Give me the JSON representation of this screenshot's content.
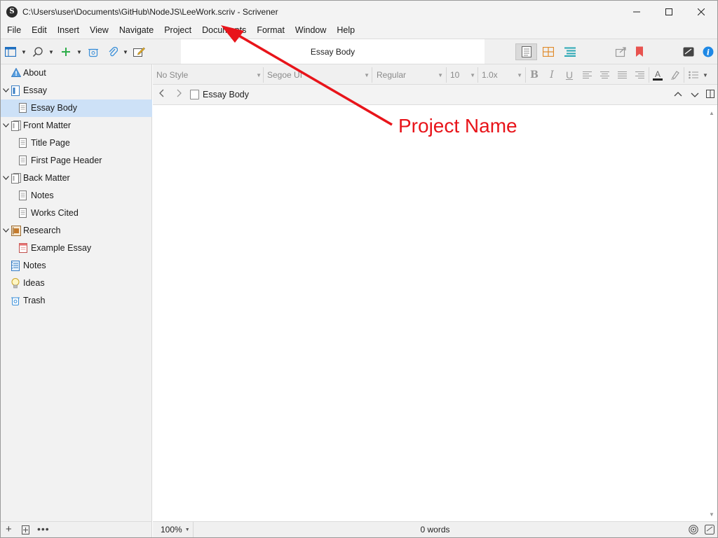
{
  "window": {
    "title": "C:\\Users\\user\\Documents\\GitHub\\NodeJS\\LeeWork.scriv - Scrivener",
    "app_icon_letter": "S"
  },
  "menu": [
    "File",
    "Edit",
    "Insert",
    "View",
    "Navigate",
    "Project",
    "Documents",
    "Format",
    "Window",
    "Help"
  ],
  "toolbar": {
    "document_title": "Essay Body"
  },
  "binder": {
    "items": [
      {
        "label": "About",
        "icon": "info-warning-icon",
        "depth": 0,
        "disclosure": "",
        "selected": false
      },
      {
        "label": "Essay",
        "icon": "draft-folder-icon",
        "depth": 0,
        "disclosure": "expanded",
        "selected": false
      },
      {
        "label": "Essay Body",
        "icon": "document-icon",
        "depth": 1,
        "disclosure": "",
        "selected": true
      },
      {
        "label": "Front Matter",
        "icon": "stack-folder-icon",
        "depth": 0,
        "disclosure": "expanded",
        "selected": false
      },
      {
        "label": "Title Page",
        "icon": "document-icon",
        "depth": 1,
        "disclosure": "",
        "selected": false
      },
      {
        "label": "First Page Header",
        "icon": "document-icon",
        "depth": 1,
        "disclosure": "",
        "selected": false
      },
      {
        "label": "Back Matter",
        "icon": "stack-folder-icon",
        "depth": 0,
        "disclosure": "expanded",
        "selected": false
      },
      {
        "label": "Notes",
        "icon": "document-icon",
        "depth": 1,
        "disclosure": "",
        "selected": false
      },
      {
        "label": "Works Cited",
        "icon": "document-icon",
        "depth": 1,
        "disclosure": "",
        "selected": false
      },
      {
        "label": "Research",
        "icon": "research-folder-icon",
        "depth": 0,
        "disclosure": "expanded",
        "selected": false
      },
      {
        "label": "Example Essay",
        "icon": "pdf-document-icon",
        "depth": 1,
        "disclosure": "",
        "selected": false
      },
      {
        "label": "Notes",
        "icon": "notebook-icon",
        "depth": 0,
        "disclosure": "",
        "selected": false
      },
      {
        "label": "Ideas",
        "icon": "lightbulb-icon",
        "depth": 0,
        "disclosure": "",
        "selected": false
      },
      {
        "label": "Trash",
        "icon": "trash-icon",
        "depth": 0,
        "disclosure": "",
        "selected": false
      }
    ]
  },
  "format_bar": {
    "style": "No Style",
    "font": "Segoe UI",
    "weight": "Regular",
    "size": "10",
    "line_spacing": "1.0x"
  },
  "header_bar": {
    "title": "Essay Body"
  },
  "footer": {
    "zoom": "100%",
    "word_count": "0 words"
  },
  "annotation": {
    "text": "Project Name",
    "color": "#e8141a"
  },
  "colors": {
    "selection": "#cde1f7",
    "accent_blue": "#1e88e5",
    "annotation_red": "#e8141a"
  }
}
